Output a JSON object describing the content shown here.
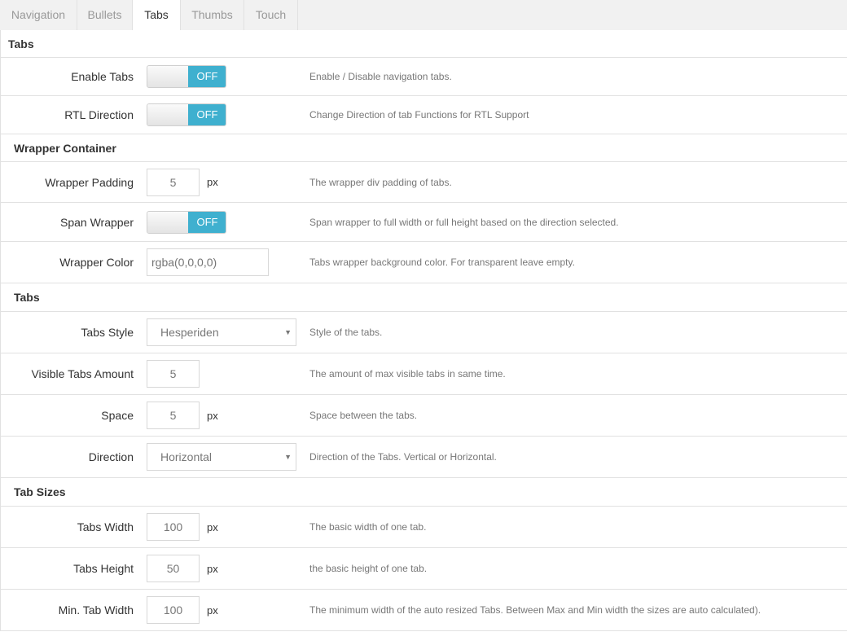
{
  "tabs": [
    {
      "label": "Navigation"
    },
    {
      "label": "Bullets"
    },
    {
      "label": "Tabs"
    },
    {
      "label": "Thumbs"
    },
    {
      "label": "Touch"
    }
  ],
  "active_tab": "Tabs",
  "sections": {
    "tabs_main": {
      "title": "Tabs",
      "enable_tabs": {
        "label": "Enable Tabs",
        "state": "OFF",
        "desc": "Enable / Disable navigation tabs."
      },
      "rtl_direction": {
        "label": "RTL Direction",
        "state": "OFF",
        "desc": "Change Direction of tab Functions for RTL Support"
      }
    },
    "wrapper": {
      "title": "Wrapper Container",
      "padding": {
        "label": "Wrapper Padding",
        "value": "5",
        "unit": "px",
        "desc": "The wrapper div padding of tabs."
      },
      "span": {
        "label": "Span Wrapper",
        "state": "OFF",
        "desc": "Span wrapper to full width or full height based on the direction selected."
      },
      "color": {
        "label": "Wrapper Color",
        "placeholder": "rgba(0,0,0,0)",
        "desc": "Tabs wrapper background color. For transparent leave empty."
      }
    },
    "tabs_style": {
      "title": "Tabs",
      "style": {
        "label": "Tabs Style",
        "value": "Hesperiden",
        "desc": "Style of the tabs."
      },
      "visible_amount": {
        "label": "Visible Tabs Amount",
        "value": "5",
        "desc": "The amount of max visible tabs in same time."
      },
      "space": {
        "label": "Space",
        "value": "5",
        "unit": "px",
        "desc": "Space between the tabs."
      },
      "direction": {
        "label": "Direction",
        "value": "Horizontal",
        "desc": "Direction of the Tabs. Vertical or Horizontal."
      }
    },
    "sizes": {
      "title": "Tab Sizes",
      "width": {
        "label": "Tabs Width",
        "value": "100",
        "unit": "px",
        "desc": "The basic width of one tab."
      },
      "height": {
        "label": "Tabs Height",
        "value": "50",
        "unit": "px",
        "desc": "the basic height of one tab."
      },
      "min_width": {
        "label": "Min. Tab Width",
        "value": "100",
        "unit": "px",
        "desc": "The minimum width of the auto resized Tabs. Between Max and Min width the sizes are auto calculated)."
      }
    }
  },
  "colors": {
    "toggle_accent": "#3fb0cf",
    "border": "#e1e1e1",
    "tabbar_bg": "#f1f1f1"
  },
  "icons": {
    "select_chevron": "chevron-down-icon",
    "side_marker": "caret-right-icon"
  }
}
